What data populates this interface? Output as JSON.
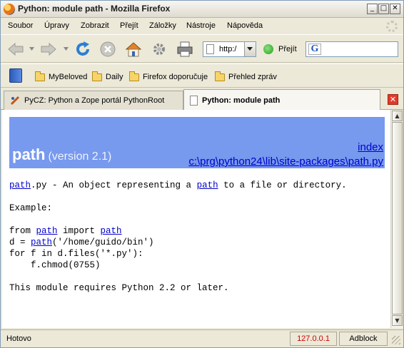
{
  "window": {
    "title": "Python: module path - Mozilla Firefox",
    "controls": [
      "minimize",
      "maximize",
      "close"
    ]
  },
  "menu": {
    "items": [
      "Soubor",
      "Úpravy",
      "Zobrazit",
      "Přejít",
      "Záložky",
      "Nástroje",
      "Nápověda"
    ]
  },
  "toolbar": {
    "icons": [
      "back-icon",
      "forward-icon",
      "reload-icon",
      "stop-icon",
      "home-icon",
      "settings-icon",
      "print-icon"
    ],
    "url_value": "http:/",
    "go_label": "Přejít",
    "search_engine_icon": "google-icon"
  },
  "bookmarks": {
    "items": [
      "MyBeloved",
      "Daily",
      "Firefox doporučuje",
      "Přehled zpráv"
    ]
  },
  "tabs": [
    {
      "label": "PyCZ: Python a Zope portál PythonRoot",
      "active": false
    },
    {
      "label": "Python: module path",
      "active": true
    }
  ],
  "page": {
    "header_color": "#7799ee",
    "title": "path",
    "version": "(version 2.1)",
    "link_index": "index",
    "link_file": "c:\\prg\\python24\\lib\\site-packages\\path.py",
    "desc_link": "path",
    "desc_rest": ".py - An object representing a ",
    "desc_link2": "path",
    "desc_rest2": " to a file or directory.",
    "example_label": "Example:",
    "code_l1_a": "from ",
    "code_l1_link": "path",
    "code_l1_b": " import ",
    "code_l1_link2": "path",
    "code_l2_a": "d = ",
    "code_l2_link": "path",
    "code_l2_b": "('/home/guido/bin')",
    "code_l3": "for f in d.files('*.py'):",
    "code_l4": "    f.chmod(0755)",
    "requirement": "This module requires Python 2.2 or later."
  },
  "status": {
    "text": "Hotovo",
    "ip": "127.0.0.1",
    "adblock": "Adblock",
    "ip_color": "#cc0000"
  }
}
